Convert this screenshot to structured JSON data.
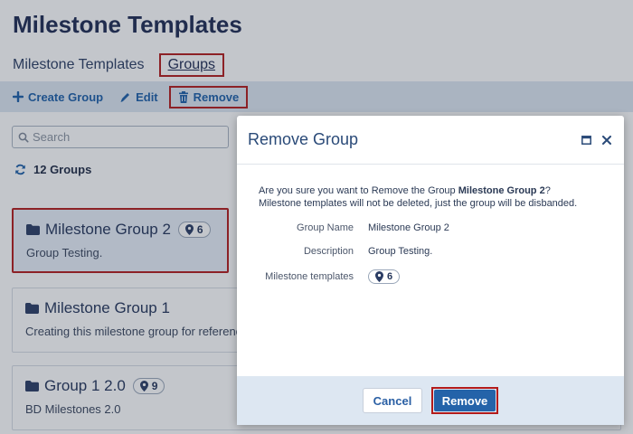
{
  "page": {
    "title": "Milestone Templates",
    "tabs": [
      {
        "label": "Milestone Templates"
      },
      {
        "label": "Groups"
      }
    ]
  },
  "toolbar": {
    "create_label": "Create Group",
    "edit_label": "Edit",
    "remove_label": "Remove"
  },
  "search": {
    "placeholder": "Search"
  },
  "groups_count_label": "12 Groups",
  "groups": [
    {
      "name": "Milestone Group 2",
      "count": "6",
      "description": "Group Testing."
    },
    {
      "name": "Milestone Group 1",
      "count": "",
      "description": "Creating this milestone group for referenc"
    },
    {
      "name": "Group 1 2.0",
      "count": "9",
      "description": "BD Milestones 2.0"
    }
  ],
  "modal": {
    "title": "Remove Group",
    "confirm_prefix": "Are you sure you want to Remove the Group ",
    "confirm_group": "Milestone Group 2",
    "confirm_suffix": "?",
    "confirm_line2": "Milestone templates will not be deleted, just the group will be disbanded.",
    "fields": [
      {
        "label": "Group Name",
        "value": "Milestone Group 2"
      },
      {
        "label": "Description",
        "value": "Group Testing."
      },
      {
        "label": "Milestone templates",
        "value": "6"
      }
    ],
    "cancel_label": "Cancel",
    "remove_label": "Remove"
  },
  "colors": {
    "accent": "#2463a9",
    "highlight_outline": "#b31b1b",
    "toolbar_bg": "#dde7f2"
  }
}
